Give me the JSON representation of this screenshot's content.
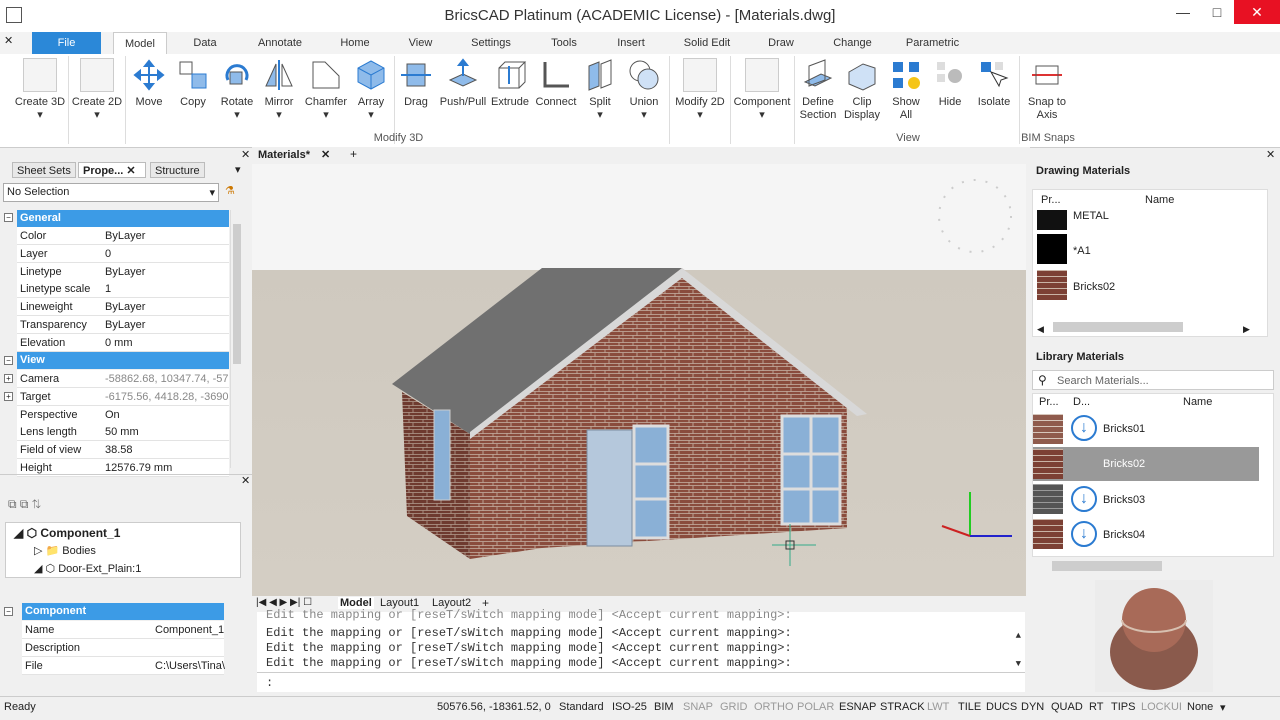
{
  "window": {
    "title": "BricsCAD Platinum (ACADEMIC License) - [Materials.dwg]",
    "min": "—",
    "max": "□",
    "close": "✕"
  },
  "menu_tabs": [
    "File",
    "Model",
    "Data",
    "Annotate",
    "Home",
    "View",
    "Settings",
    "Tools",
    "Insert",
    "Solid Edit",
    "Draw",
    "Change",
    "Parametric"
  ],
  "ribbon": {
    "buttons": [
      "Create 3D",
      "Create 2D",
      "Move",
      "Copy",
      "Rotate",
      "Mirror",
      "Chamfer",
      "Array",
      "Drag",
      "Push/Pull",
      "Extrude",
      "Connect",
      "Split",
      "Union",
      "Modify 2D",
      "Component",
      "Define Section",
      "Clip Display",
      "Show All",
      "Hide",
      "Isolate",
      "Snap to Axis"
    ],
    "groups": [
      "Modify 3D",
      "View",
      "BIM Snaps"
    ]
  },
  "left": {
    "tabs": [
      "Sheet Sets",
      "Prope...",
      "Structure"
    ],
    "selection": "No Selection",
    "sections": {
      "general": "General",
      "view": "View",
      "component": "Component"
    },
    "general_rows": [
      {
        "k": "Color",
        "v": "ByLayer"
      },
      {
        "k": "Layer",
        "v": "0"
      },
      {
        "k": "Linetype",
        "v": "ByLayer"
      },
      {
        "k": "Linetype scale",
        "v": "1"
      },
      {
        "k": "Lineweight",
        "v": "ByLayer"
      },
      {
        "k": "Transparency",
        "v": "ByLayer"
      },
      {
        "k": "Elevation",
        "v": "0 mm"
      }
    ],
    "view_rows": [
      {
        "k": "Camera",
        "v": "-58862.68, 10347.74, -57"
      },
      {
        "k": "Target",
        "v": "-6175.56, 4418.28, -3690"
      },
      {
        "k": "Perspective",
        "v": "On"
      },
      {
        "k": "Lens length",
        "v": "50 mm"
      },
      {
        "k": "Field of view",
        "v": "38.58"
      },
      {
        "k": "Height",
        "v": "12576.79 mm"
      }
    ],
    "tree": [
      "Component_1",
      "Bodies",
      "Door-Ext_Plain:1"
    ],
    "component_rows": [
      {
        "k": "Name",
        "v": "Component_1"
      },
      {
        "k": "Description",
        "v": ""
      },
      {
        "k": "File",
        "v": "C:\\Users\\Tina\\"
      }
    ]
  },
  "doc": {
    "tab": "Materials*",
    "close": "✕",
    "add": "+"
  },
  "layouts": [
    "Model",
    "Layout1",
    "Layout2",
    "+"
  ],
  "command": {
    "lines": [
      "Edit the mapping or [reseT/sWitch mapping mode] <Accept current mapping>:",
      "Edit the mapping or [reseT/sWitch mapping mode] <Accept current mapping>:",
      "Edit the mapping or [reseT/sWitch mapping mode] <Accept current mapping>:",
      "Edit the mapping or [reseT/sWitch mapping mode] <Accept current mapping>:"
    ],
    "prompt": ":"
  },
  "right": {
    "drawing_title": "Drawing Materials",
    "drawing_cols": [
      "Pr...",
      "Name"
    ],
    "drawing_items": [
      "METAL",
      "*A1",
      "Bricks02"
    ],
    "library_title": "Library Materials",
    "search_placeholder": "Search Materials...",
    "library_cols": [
      "Pr...",
      "D...",
      "Name"
    ],
    "library_items": [
      "Bricks01",
      "Bricks02",
      "Bricks03",
      "Bricks04"
    ]
  },
  "status": {
    "ready": "Ready",
    "coords": "50576.56, -18361.52, 0",
    "items": [
      {
        "t": "Standard",
        "on": true
      },
      {
        "t": "ISO-25",
        "on": true
      },
      {
        "t": "BIM",
        "on": true
      },
      {
        "t": "SNAP",
        "on": false
      },
      {
        "t": "GRID",
        "on": false
      },
      {
        "t": "ORTHO",
        "on": false
      },
      {
        "t": "POLAR",
        "on": false
      },
      {
        "t": "ESNAP",
        "on": true
      },
      {
        "t": "STRACK",
        "on": true
      },
      {
        "t": "LWT",
        "on": false
      },
      {
        "t": "TILE",
        "on": true
      },
      {
        "t": "DUCS",
        "on": true
      },
      {
        "t": "DYN",
        "on": true
      },
      {
        "t": "QUAD",
        "on": true
      },
      {
        "t": "RT",
        "on": true
      },
      {
        "t": "TIPS",
        "on": true
      },
      {
        "t": "LOCKUI",
        "on": false
      },
      {
        "t": "None",
        "on": true
      }
    ]
  },
  "colors": {
    "accent": "#2b88d8",
    "section": "#3c9be6",
    "close": "#e81123"
  }
}
